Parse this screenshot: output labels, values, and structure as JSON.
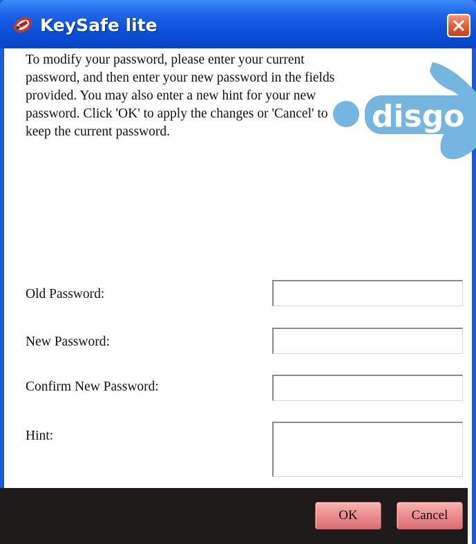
{
  "window": {
    "title": "KeySafe lite",
    "close_label": "×"
  },
  "intro_text": "To modify your password, please enter your current password, and then enter your new password in the fields provided. You may also enter a new hint for your new password. Click 'OK' to apply the changes or 'Cancel' to keep the current password.",
  "logo": {
    "text": "disgo",
    "color": "#74b6e0"
  },
  "form": {
    "old_password_label": "Old Password:",
    "old_password_value": "",
    "new_password_label": "New Password:",
    "new_password_value": "",
    "confirm_password_label": "Confirm New Password:",
    "confirm_password_value": "",
    "hint_label": "Hint:",
    "hint_value": ""
  },
  "buttons": {
    "ok": "OK",
    "cancel": "Cancel"
  },
  "colors": {
    "titlebar": "#0a4fd8",
    "footer": "#1f1b1b",
    "button": "#e9888a",
    "close_button": "#e35a2c"
  },
  "icons": {
    "app": "keysafe-app-icon",
    "close": "close-icon"
  }
}
